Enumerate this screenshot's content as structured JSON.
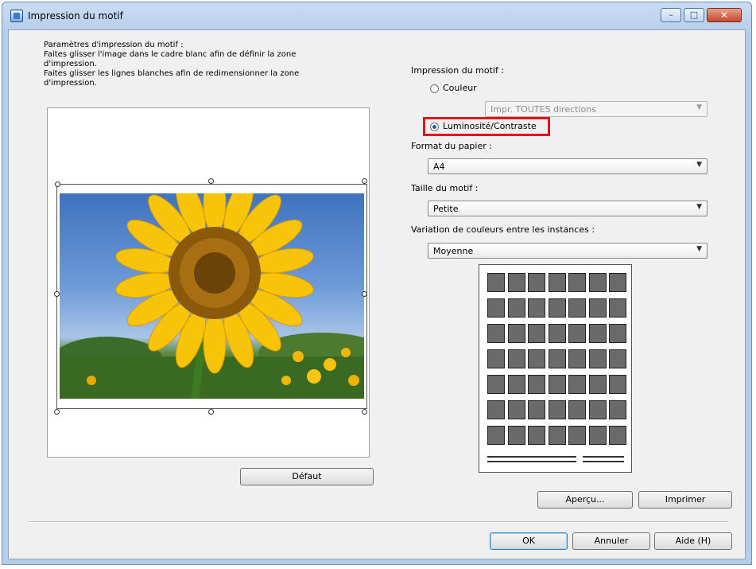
{
  "window": {
    "title": "Impression du motif",
    "minimize_glyph": "–",
    "maximize_glyph": "□",
    "close_glyph": "✕"
  },
  "left_panel": {
    "description_lines": [
      "Paramètres d'impression du motif :",
      "Faites glisser l'image dans le cadre blanc afin de définir la zone",
      "d'impression.",
      "Faites glisser les lignes blanches afin de redimensionner la zone",
      "d'impression."
    ],
    "default_button": "Défaut"
  },
  "right_panel": {
    "pattern_print_label": "Impression du motif :",
    "color_option": "Couleur",
    "color_option_selected": false,
    "direction_select": "Impr. TOUTES directions",
    "direction_select_enabled": false,
    "brightness_option": "Luminosité/Contraste",
    "brightness_option_selected": true,
    "paper_format_label": "Format du papier :",
    "paper_format_value": "A4",
    "pattern_size_label": "Taille du motif :",
    "pattern_size_value": "Petite",
    "color_variation_label": "Variation de couleurs entre les instances :",
    "color_variation_value": "Moyenne",
    "layout_grid": {
      "columns": 7,
      "rows": 7
    },
    "highlight_color": "#e0141e"
  },
  "buttons": {
    "preview": "Aperçu...",
    "print": "Imprimer",
    "ok": "OK",
    "cancel": "Annuler",
    "help": "Aide (H)"
  },
  "icons": {
    "app": "app-icon",
    "dropdown": "chevron-down-icon"
  }
}
